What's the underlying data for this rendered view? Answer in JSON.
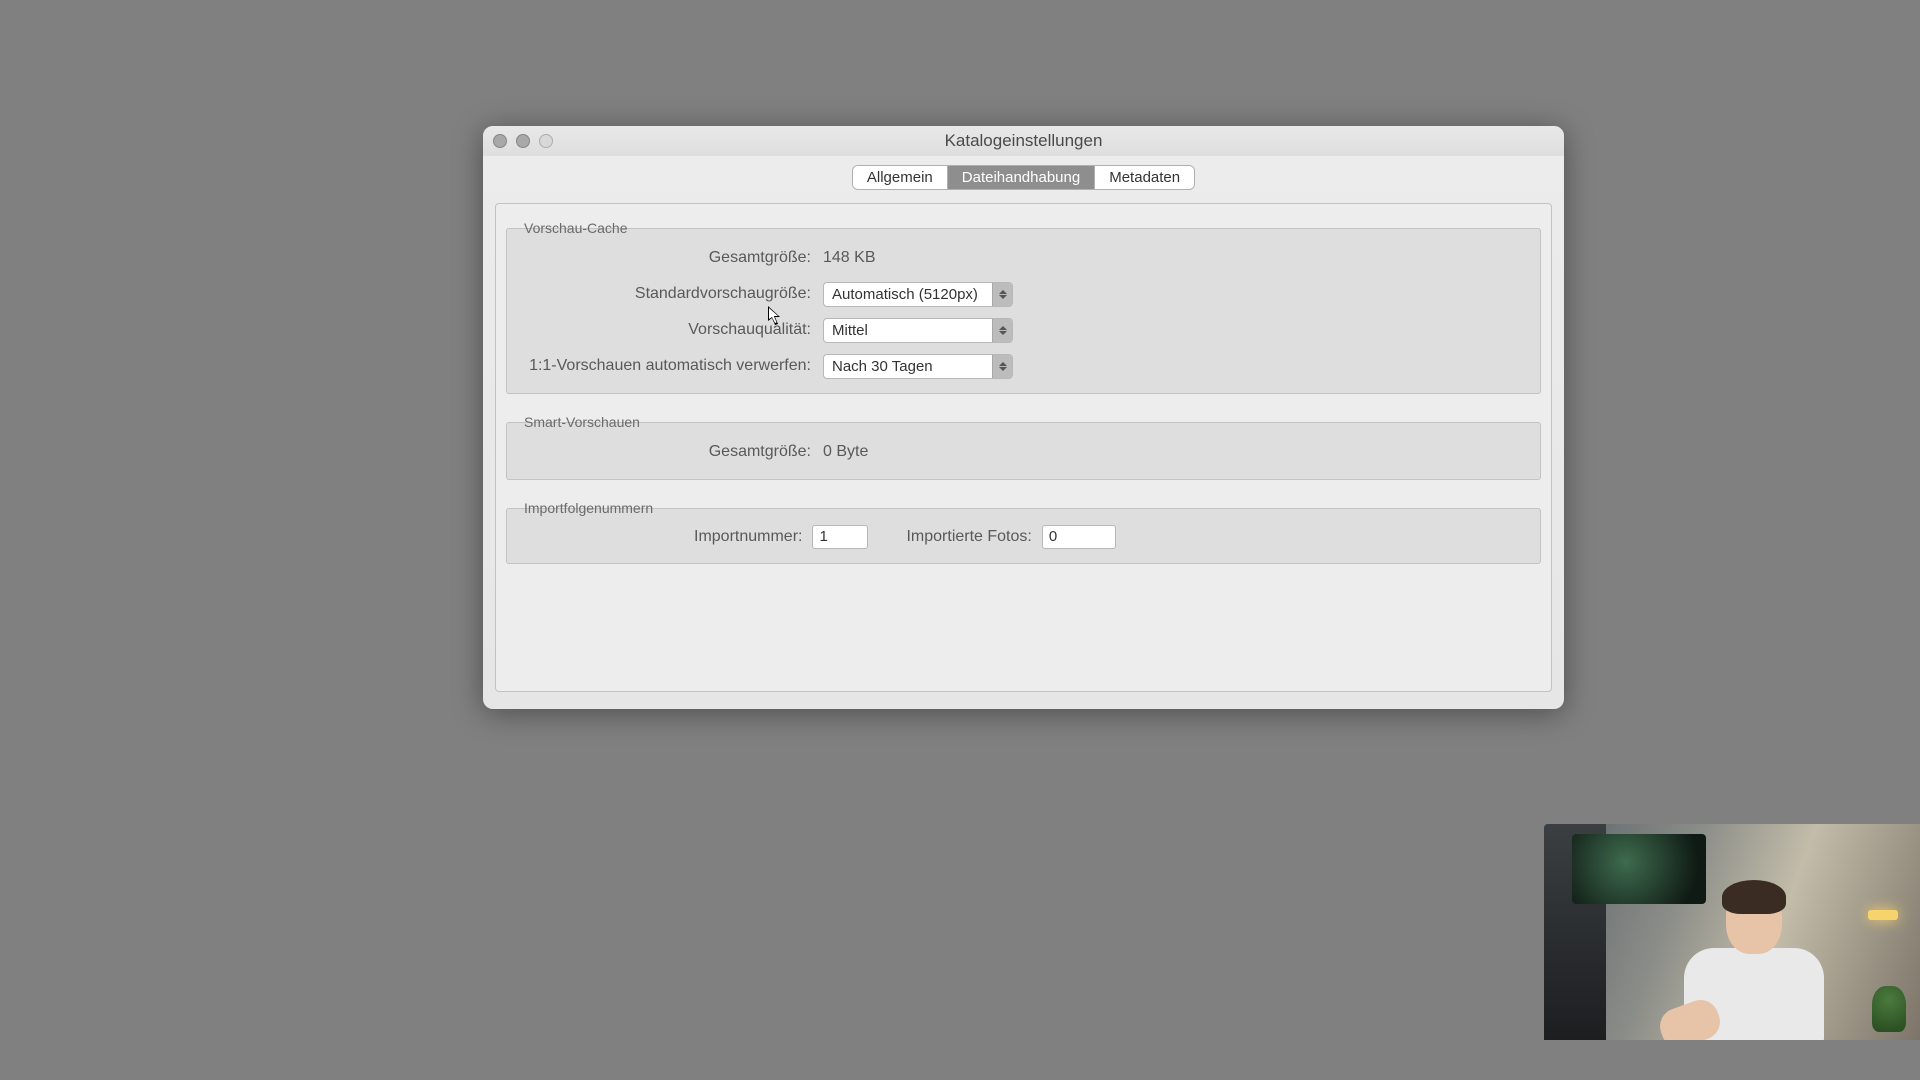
{
  "window": {
    "title": "Katalogeinstellungen"
  },
  "tabs": {
    "general": "Allgemein",
    "file_handling": "Dateihandhabung",
    "metadata": "Metadaten",
    "active": "file_handling"
  },
  "sections": {
    "preview_cache": {
      "title": "Vorschau-Cache",
      "total_size_label": "Gesamtgröße:",
      "total_size_value": "148 KB",
      "std_size_label": "Standardvorschaugröße:",
      "std_size_value": "Automatisch (5120px)",
      "quality_label": "Vorschauqualität:",
      "quality_value": "Mittel",
      "discard_label": "1:1-Vorschauen automatisch verwerfen:",
      "discard_value": "Nach 30 Tagen"
    },
    "smart_previews": {
      "title": "Smart-Vorschauen",
      "total_size_label": "Gesamtgröße:",
      "total_size_value": "0 Byte"
    },
    "import_numbers": {
      "title": "Importfolgenummern",
      "import_number_label": "Importnummer:",
      "import_number_value": "1",
      "imported_photos_label": "Importierte Fotos:",
      "imported_photos_value": "0"
    }
  }
}
